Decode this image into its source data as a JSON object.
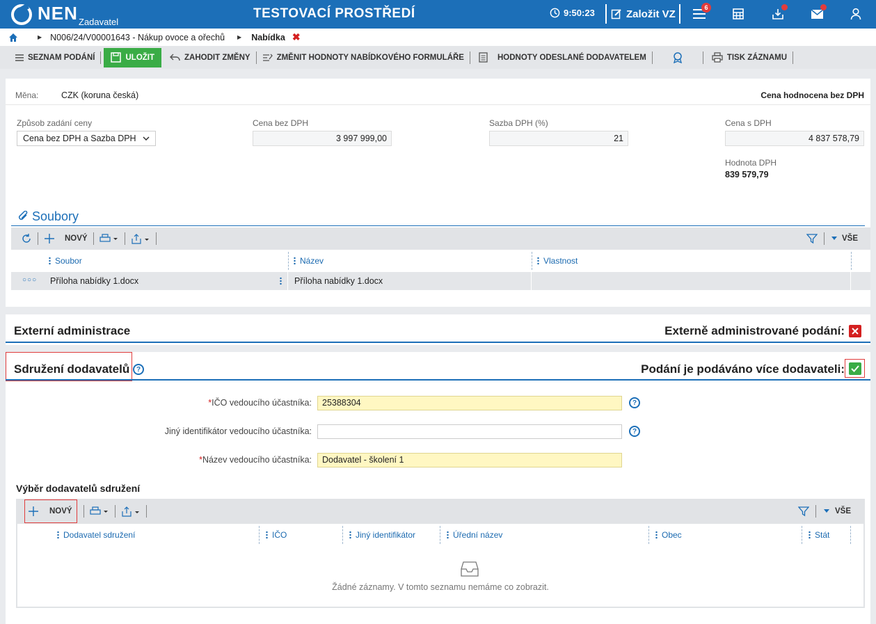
{
  "header": {
    "brand": "NEN",
    "role": "Zadavatel",
    "env_title": "TESTOVACÍ PROSTŘEDÍ",
    "time": "9:50:23",
    "create_label": "Založit VZ",
    "tasks_badge": "6"
  },
  "breadcrumb": {
    "path": "N006/24/V00001643 - Nákup ovoce a ořechů",
    "current": "Nabídka",
    "close": "✖"
  },
  "toolbar": {
    "list": "SEZNAM PODÁNÍ",
    "save": "ULOŽIT",
    "discard": "ZAHODIT ZMĚNY",
    "change_values": "ZMĚNIT HODNOTY NABÍDKOVÉHO FORMULÁŘE",
    "sent_values": "HODNOTY ODESLANÉ DODAVATELEM",
    "print": "TISK ZÁZNAMU"
  },
  "price": {
    "currency_label": "Měna:",
    "currency_value": "CZK (koruna česká)",
    "eval_note": "Cena hodnocena bez DPH",
    "mode_label": "Způsob zadání ceny",
    "mode_value": "Cena bez DPH a Sazba DPH",
    "net_label": "Cena bez DPH",
    "net_value": "3 997 999,00",
    "vat_rate_label": "Sazba DPH (%)",
    "vat_rate_value": "21",
    "gross_label": "Cena s DPH",
    "gross_value": "4 837 578,79",
    "vat_amount_label": "Hodnota DPH",
    "vat_amount_value": "839 579,79"
  },
  "files": {
    "title": "Soubory",
    "new": "NOVÝ",
    "all": "VŠE",
    "columns": [
      "Soubor",
      "Název",
      "Vlastnost"
    ],
    "rows": [
      {
        "file": "Příloha nabídky 1.docx",
        "name": "Příloha nabídky 1.docx",
        "property": ""
      }
    ]
  },
  "external": {
    "title": "Externí administrace",
    "flag_label": "Externě administrované podání:"
  },
  "consortium": {
    "title": "Sdružení dodavatelů",
    "flag_label": "Podání je podáváno více dodavateli:",
    "ico_label": "IČO vedoucího účastníka:",
    "ico_value": "25388304",
    "other_id_label": "Jiný identifikátor vedoucího účastníka:",
    "other_id_value": "",
    "name_label": "Název vedoucího účastníka:",
    "name_value": "Dodavatel - školení 1",
    "req_mark": "*",
    "help": "?"
  },
  "suppliers": {
    "title": "Výběr dodavatelů sdružení",
    "new": "NOVÝ",
    "all": "VŠE",
    "columns": [
      "Dodavatel sdružení",
      "IČO",
      "Jiný identifikátor",
      "Úřední název",
      "Obec",
      "Stát"
    ],
    "empty": "Žádné záznamy. V tomto seznamu nemáme co zobrazit."
  },
  "colors": {
    "brand": "#1c6fb8",
    "save": "#3aac46",
    "danger": "#d42020",
    "required_bg": "#fff7c2"
  }
}
